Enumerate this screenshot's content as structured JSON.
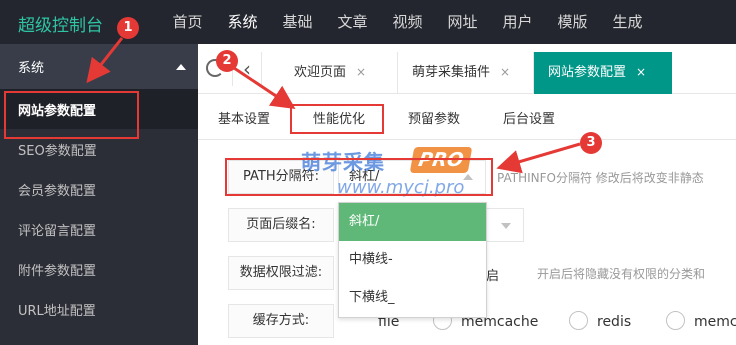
{
  "app": {
    "title": "超级控制台"
  },
  "topnav": [
    "首页",
    "系统",
    "基础",
    "文章",
    "视频",
    "网址",
    "用户",
    "模版",
    "生成"
  ],
  "sidebar": {
    "group": "系统",
    "items": [
      {
        "label": "网站参数配置"
      },
      {
        "label": "SEO参数配置"
      },
      {
        "label": "会员参数配置"
      },
      {
        "label": "评论留言配置"
      },
      {
        "label": "附件参数配置"
      },
      {
        "label": "URL地址配置"
      }
    ]
  },
  "tabs": [
    {
      "label": "欢迎页面",
      "close": "×"
    },
    {
      "label": "萌芽采集插件",
      "close": "×"
    },
    {
      "label": "网站参数配置",
      "close": "×"
    }
  ],
  "subtabs": [
    "基本设置",
    "性能优化",
    "预留参数",
    "后台设置"
  ],
  "form": {
    "path_sep": {
      "label": "PATH分隔符:",
      "value": "斜杠/",
      "hint": "PATHINFO分隔符 修改后将改变非静态"
    },
    "page_suffix": {
      "label": "页面后缀名:"
    },
    "perm_filter": {
      "label": "数据权限过滤:",
      "trailing": "启",
      "hint": "开启后将隐藏没有权限的分类和"
    },
    "cache": {
      "label": "缓存方式:",
      "options": [
        "file",
        "memcache",
        "redis",
        "memc"
      ]
    }
  },
  "dropdown": {
    "options": [
      "斜杠/",
      "中横线-",
      "下横线_"
    ]
  },
  "watermark": {
    "brand": "萌芽采集",
    "pro": "PRO",
    "url": "www.mycj.pro"
  },
  "annotations": [
    "1",
    "2",
    "3"
  ],
  "colors": {
    "brand": "#2ec5a5",
    "active_tab": "#009688",
    "dropdown_selected": "#5fb878",
    "annotation": "#e53935"
  }
}
